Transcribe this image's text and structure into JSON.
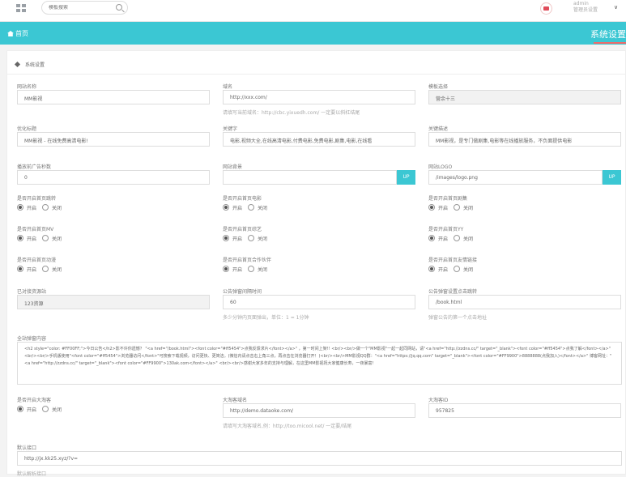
{
  "topbar": {
    "search_placeholder": "模板搜索",
    "user_name": "admin",
    "user_role": "管理员设置",
    "dropdown_arrow": "∨"
  },
  "nav": {
    "home_label": "首页",
    "page_title": "系统设置"
  },
  "section": {
    "title": "系统设置"
  },
  "fields": {
    "site_name": {
      "label": "网站名称",
      "value": "MM影视"
    },
    "domain": {
      "label": "域名",
      "value": "http://xxx.com/",
      "tip": "请填写当前域名：http://cbc.yixuedh.com/ 一定要以斜杠结尾"
    },
    "template": {
      "label": "模板选择",
      "value": "营余十三"
    },
    "seo_title": {
      "label": "优化标题",
      "value": "MM影视 - 在线免费高清电影!"
    },
    "keywords": {
      "label": "关键字",
      "value": "电影,视频大全,在线高清电影,付费电影,免费电影,剧集,电影,在线看"
    },
    "description": {
      "label": "关键描述",
      "value": "MM影视，是专门做剧集,电影等在线播放服务，不负面提供电影"
    },
    "ad_seconds": {
      "label": "播放前广告秒数",
      "value": "0"
    },
    "background": {
      "label": "网站背景",
      "value": "",
      "button": "UP"
    },
    "logo": {
      "label": "网站LOGO",
      "value": "/images/logo.png",
      "button": "UP"
    },
    "pc_redirect": {
      "label": "是否开启首页跳转",
      "options": [
        "开启",
        "关闭"
      ],
      "selected": 0
    },
    "movies": {
      "label": "是否开启首页电影",
      "options": [
        "开启",
        "关闭"
      ],
      "selected": 0
    },
    "series": {
      "label": "是否开启首页剧集",
      "options": [
        "开启",
        "关闭"
      ],
      "selected": 0
    },
    "mv": {
      "label": "是否开启首页MV",
      "options": [
        "开启",
        "关闭"
      ],
      "selected": 0
    },
    "variety": {
      "label": "是否开启首页综艺",
      "options": [
        "开启",
        "关闭"
      ],
      "selected": 0
    },
    "yy": {
      "label": "是否开启首页YY",
      "options": [
        "开启",
        "关闭"
      ],
      "selected": 0
    },
    "anime": {
      "label": "是否开启首页动漫",
      "options": [
        "开启",
        "关闭"
      ],
      "selected": 0
    },
    "partner": {
      "label": "是否开启首页合作伙伴",
      "options": [
        "开启",
        "关闭"
      ],
      "selected": 0
    },
    "friend_links": {
      "label": "是否开启首页友情链接",
      "options": [
        "开启",
        "关闭"
      ],
      "selected": 0
    },
    "api_name": {
      "label": "已对接资源站",
      "value": "123资源"
    },
    "popup_interval": {
      "label": "公告弹窗间隔时间",
      "value": "60",
      "tip": "多少分钟内页面弹出，单位：1 = 1分钟"
    },
    "popup_link": {
      "label": "公告弹窗设置点击跳转",
      "value": "/book.html",
      "tip": "弹窗公告的第一个点击地址"
    },
    "announcement": {
      "label": "全站弹窗内容",
      "value": "<h2 style=\"color: #FF00FF;\">今日公告</h2>影不许你遗憾？ \"<a href=\"/book.html\"><font color=\"#ff5454\">点我反馈求片</font></a>\" ，第一时间上架!! <br/><br/>做一个\"MM影视\"一起一起同网站，请\"<a href=\"http://zzdns.cc/\" target=\"_blank\"><font color=\"#ff5454\">点我了解</font></a>\" <br/><br/>手机版使用\"<font color=\"#ff5454\">浏览器访问</font>\"可搜索下载视频，访问更快、更简洁。(微信内请点击右上角三点，再点击在浏览器打开！)<br/><br/>MM影视QQ群：\"<a href=\"https://jq.qq.com\" target=\"_blank\"><font color=\"#FF9900\">8888888(点我加入)</font></a>\" 博客网址：\"<a href=\"http://zzdns.cc/\" target=\"_blank\"><font color=\"#FF9900\">130ak.com</font></a>\" <br/><br/>感谢大家多年的支持与理解，在这里MM影视祝大家健康长寿，一夜暴富!"
    },
    "taobao": {
      "label": "是否开启大淘客",
      "options": [
        "开启",
        "关闭"
      ],
      "selected": 0
    },
    "taobao_domain": {
      "label": "大淘客域名",
      "value": "http://demo.dataoke.com/",
      "tip": "请填写大淘客域名,例：http://too.micool.net/ 一定要/结尾"
    },
    "taobao_id": {
      "label": "大淘客ID",
      "value": "957825"
    },
    "default_api": {
      "label": "默认接口",
      "value": "http://jx.kk25.xyz/?v=",
      "tip": "默认解析接口"
    }
  },
  "colors": {
    "accent": "#3bc7d3",
    "accent_line": "#f06a6a"
  }
}
